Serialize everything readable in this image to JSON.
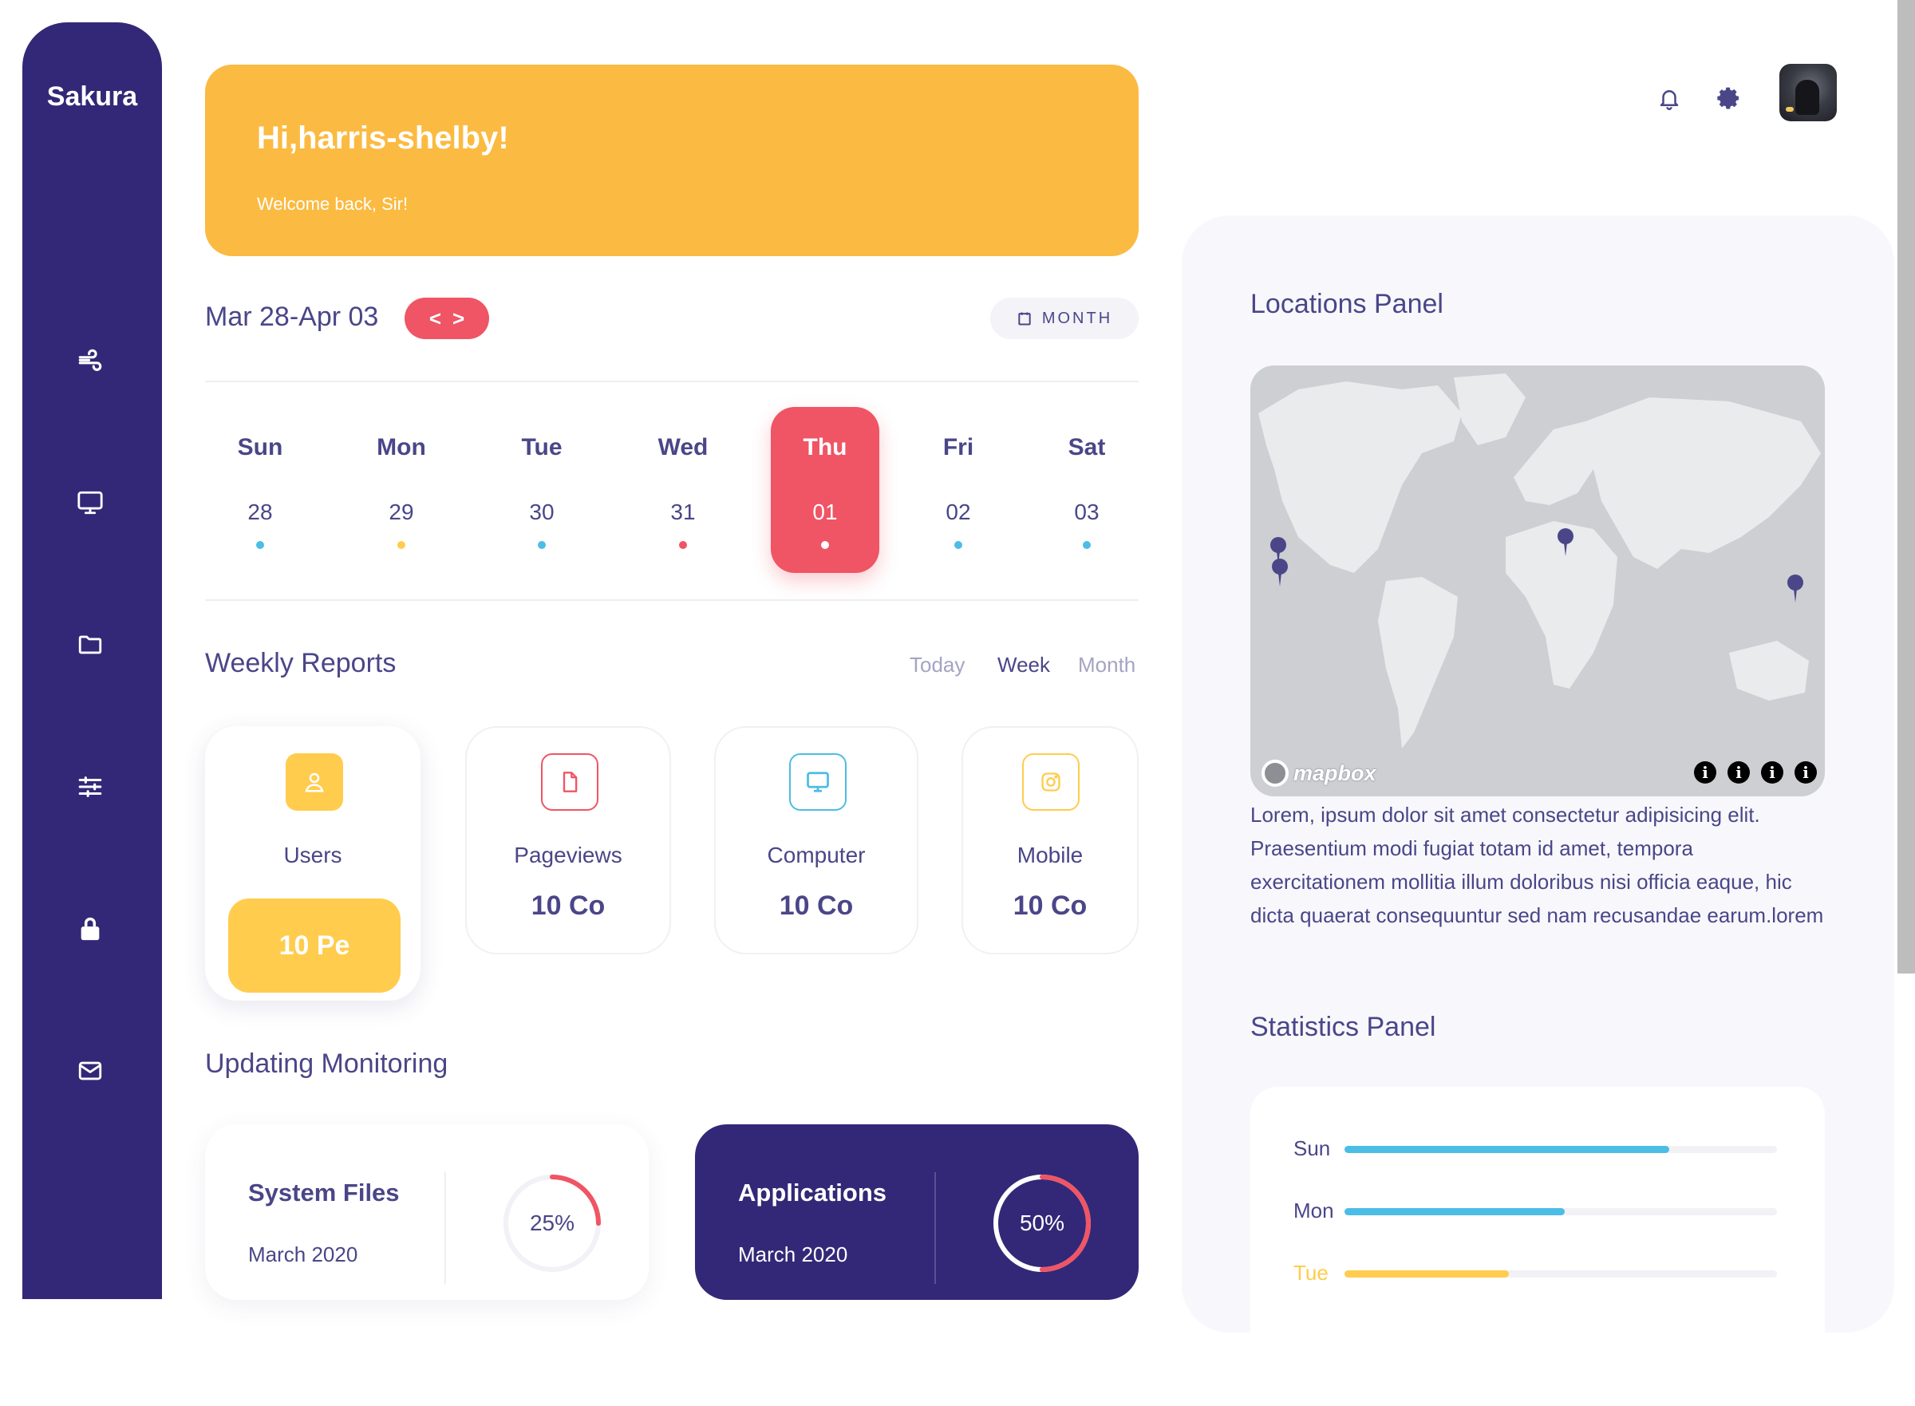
{
  "sidebar": {
    "logo": "Sakura",
    "items": [
      {
        "icon": "wind-icon"
      },
      {
        "icon": "monitor-icon"
      },
      {
        "icon": "folder-icon"
      },
      {
        "icon": "sliders-icon"
      },
      {
        "icon": "lock-icon"
      },
      {
        "icon": "mail-icon"
      }
    ]
  },
  "header": {
    "notification_icon": "bell-icon",
    "settings_icon": "gear-icon"
  },
  "greeting": {
    "title": "Hi,harris-shelby!",
    "subtitle": "Welcome back, Sir!"
  },
  "calendar": {
    "range": "Mar 28-Apr 03",
    "month_button": "MONTH",
    "days": [
      {
        "name": "Sun",
        "num": "28",
        "dot": "#4cbde4"
      },
      {
        "name": "Mon",
        "num": "29",
        "dot": "#ffcc4d"
      },
      {
        "name": "Tue",
        "num": "30",
        "dot": "#4cbde4"
      },
      {
        "name": "Wed",
        "num": "31",
        "dot": "#ef5565"
      },
      {
        "name": "Thu",
        "num": "01",
        "dot": "#ffffff",
        "active": true
      },
      {
        "name": "Fri",
        "num": "02",
        "dot": "#4cbde4"
      },
      {
        "name": "Sat",
        "num": "03",
        "dot": "#4cbde4"
      }
    ]
  },
  "weekly": {
    "title": "Weekly Reports",
    "filters": [
      "Today",
      "Week",
      "Month"
    ],
    "selected_filter": "Week",
    "cards": [
      {
        "label": "Users",
        "value": "10 Pe",
        "icon": "user-icon",
        "color": "#ffcc4d"
      },
      {
        "label": "Pageviews",
        "value": "10 Co",
        "icon": "file-icon",
        "color": "#ef5565"
      },
      {
        "label": "Computer",
        "value": "10 Co",
        "icon": "monitor-icon",
        "color": "#4cbde4"
      },
      {
        "label": "Mobile",
        "value": "10 Co",
        "icon": "instagram-icon",
        "color": "#ffcc4d"
      }
    ]
  },
  "monitoring": {
    "title": "Updating Monitoring",
    "cards": [
      {
        "title": "System Files",
        "date": "March 2020",
        "percent": "25%",
        "progress": 0.25
      },
      {
        "title": "Applications",
        "date": "March 2020",
        "percent": "50%",
        "progress": 0.5
      }
    ]
  },
  "locations": {
    "title": "Locations Panel",
    "map_attribution": "mapbox",
    "description": "Lorem, ipsum dolor sit amet consectetur adipisicing elit. Praesentium modi fugiat totam id amet, tempora exercitationem mollitia illum doloribus nisi officia eaque, hic dicta quaerat consequuntur sed nam recusandae earum.lorem"
  },
  "statistics": {
    "title": "Statistics Panel",
    "rows": [
      {
        "day": "Sun",
        "value": 0.75,
        "color": "#4cbde4"
      },
      {
        "day": "Mon",
        "value": 0.51,
        "color": "#4cbde4"
      },
      {
        "day": "Tue",
        "value": 0.38,
        "color": "#ffcc4d"
      }
    ]
  },
  "colors": {
    "primary": "#332877",
    "accent_red": "#ef5565",
    "accent_yellow": "#fbba41",
    "accent_blue": "#4cbde4"
  }
}
